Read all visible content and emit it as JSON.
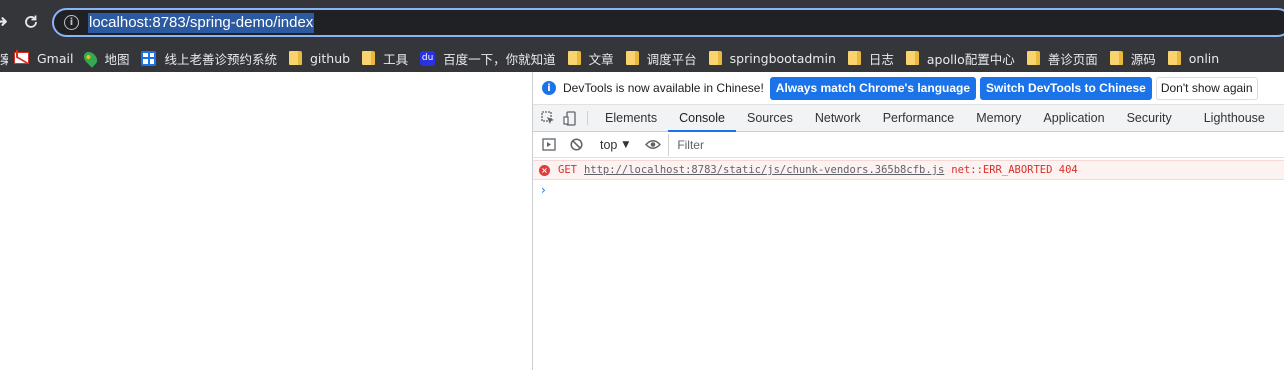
{
  "browser": {
    "url": "localhost:8783/spring-demo/index",
    "nav_icons": [
      "forward-icon",
      "reload-icon",
      "info-icon"
    ],
    "bookmarks_cut_label": "案",
    "bookmarks": [
      {
        "label": "Gmail",
        "icon": "gmail-icon"
      },
      {
        "label": "地图",
        "icon": "maps-icon"
      },
      {
        "label": "线上老善诊预约系统",
        "icon": "grid-icon"
      },
      {
        "label": "github",
        "icon": "folder-icon"
      },
      {
        "label": "工具",
        "icon": "folder-icon"
      },
      {
        "label": "百度一下，你就知道",
        "icon": "baidu-icon"
      },
      {
        "label": "文章",
        "icon": "folder-icon"
      },
      {
        "label": "调度平台",
        "icon": "folder-icon"
      },
      {
        "label": "springbootadmin",
        "icon": "folder-icon"
      },
      {
        "label": "日志",
        "icon": "folder-icon"
      },
      {
        "label": "apollo配置中心",
        "icon": "folder-icon"
      },
      {
        "label": "善诊页面",
        "icon": "folder-icon"
      },
      {
        "label": "源码",
        "icon": "folder-icon"
      },
      {
        "label": "onlin",
        "icon": "folder-icon"
      }
    ]
  },
  "devtools": {
    "infobar": {
      "message": "DevTools is now available in Chinese!",
      "primary_button": "Always match Chrome's language",
      "secondary_button": "Switch DevTools to Chinese",
      "dismiss_button": "Don't show again"
    },
    "tabs": [
      {
        "label": "Elements",
        "active": false
      },
      {
        "label": "Console",
        "active": true
      },
      {
        "label": "Sources",
        "active": false
      },
      {
        "label": "Network",
        "active": false
      },
      {
        "label": "Performance",
        "active": false
      },
      {
        "label": "Memory",
        "active": false
      },
      {
        "label": "Application",
        "active": false
      },
      {
        "label": "Security",
        "active": false
      },
      {
        "label": "Lighthouse",
        "active": false
      }
    ],
    "console": {
      "context": "top",
      "filter_placeholder": "Filter",
      "error": {
        "method": "GET",
        "url": "http://localhost:8783/static/js/chunk-vendors.365b8cfb.js",
        "status": "net::ERR_ABORTED 404"
      },
      "prompt_symbol": "›"
    }
  },
  "colors": {
    "chrome_bg": "#35363a",
    "accent": "#1a73e8",
    "error": "#d93025"
  }
}
